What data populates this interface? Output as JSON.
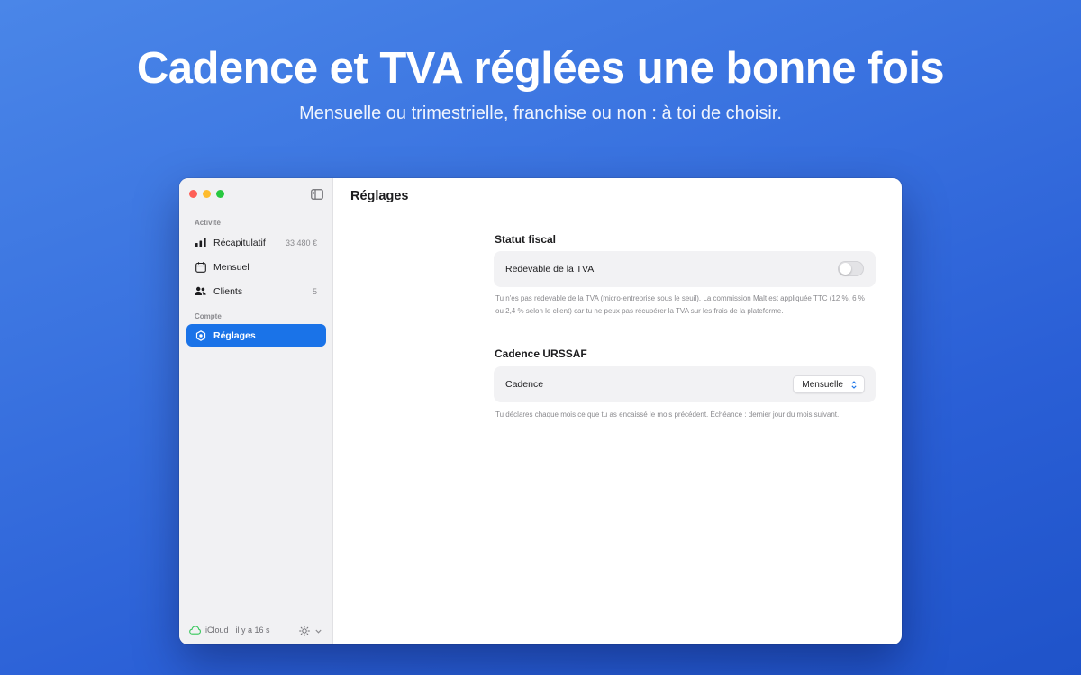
{
  "hero": {
    "title": "Cadence et TVA réglées une bonne fois",
    "subtitle": "Mensuelle ou trimestrielle, franchise ou non : à toi de choisir."
  },
  "sidebar": {
    "section_activity": "Activité",
    "section_account": "Compte",
    "items": [
      {
        "label": "Récapitulatif",
        "badge": "33 480 €",
        "icon": "chart-bars-icon"
      },
      {
        "label": "Mensuel",
        "badge": "",
        "icon": "calendar-icon"
      },
      {
        "label": "Clients",
        "badge": "5",
        "icon": "people-icon"
      },
      {
        "label": "Réglages",
        "badge": "",
        "icon": "settings-icon",
        "active": true
      }
    ],
    "footer": {
      "sync_status": "iCloud · il y a 16 s"
    }
  },
  "main": {
    "title": "Réglages",
    "fiscal": {
      "heading": "Statut fiscal",
      "row_label": "Redevable de la TVA",
      "toggle_on": false,
      "help": "Tu n'es pas redevable de la TVA (micro-entreprise sous le seuil). La commission Malt est appliquée TTC (12 %, 6 % ou 2,4 % selon le client) car tu ne peux pas récupérer la TVA sur les frais de la plateforme."
    },
    "cadence": {
      "heading": "Cadence URSSAF",
      "row_label": "Cadence",
      "selected": "Mensuelle",
      "help": "Tu déclares chaque mois ce que tu as encaissé le mois précédent. Échéance : dernier jour du mois suivant."
    }
  },
  "colors": {
    "accent": "#1a73e8",
    "background_top": "#4a86e8",
    "background_bottom": "#1f53c9"
  }
}
